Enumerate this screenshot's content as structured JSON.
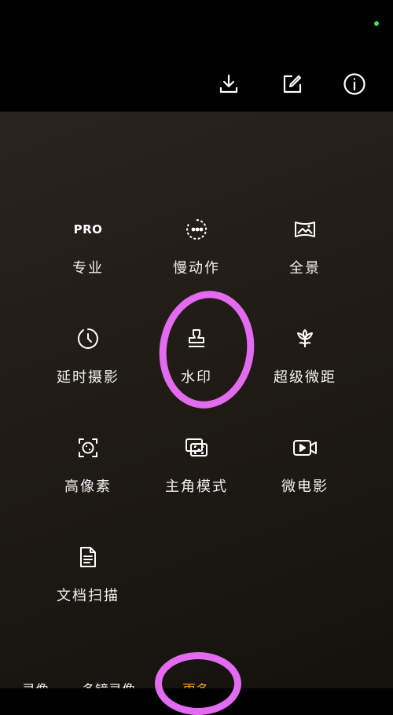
{
  "toolbar": {
    "icons": [
      "download-icon",
      "edit-icon",
      "info-icon"
    ]
  },
  "status_dot_color": "#3ddc5a",
  "highlight_color": "#e36bf0",
  "active_color": "#f5a623",
  "modes": [
    {
      "label": "专业",
      "icon": "pro-badge",
      "icon_text": "PRO"
    },
    {
      "label": "慢动作",
      "icon": "slow-motion-icon"
    },
    {
      "label": "全景",
      "icon": "panorama-icon"
    },
    {
      "label": "延时摄影",
      "icon": "timelapse-icon"
    },
    {
      "label": "水印",
      "icon": "watermark-stamp-icon"
    },
    {
      "label": "超级微距",
      "icon": "macro-flower-icon"
    },
    {
      "label": "高像素",
      "icon": "high-resolution-icon"
    },
    {
      "label": "主角模式",
      "icon": "protagonist-mode-icon"
    },
    {
      "label": "微电影",
      "icon": "micro-movie-icon"
    },
    {
      "label": "文档扫描",
      "icon": "document-scan-icon"
    }
  ],
  "bottom_bar": {
    "items": [
      "录像",
      "多镜录像",
      "更多"
    ]
  }
}
